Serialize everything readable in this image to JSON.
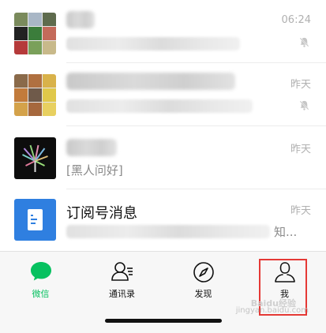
{
  "chats": [
    {
      "time": "06:24",
      "muted": true
    },
    {
      "time": "昨天",
      "muted": true
    },
    {
      "time": "昨天",
      "muted": false,
      "preview": "[黑人问好]"
    },
    {
      "time": "昨天",
      "muted": false,
      "name": "订阅号消息",
      "preview_suffix": "知..."
    }
  ],
  "tabs": [
    {
      "label": "微信",
      "icon": "chat-bubble-icon",
      "active": true
    },
    {
      "label": "通讯录",
      "icon": "contacts-icon",
      "active": false
    },
    {
      "label": "发现",
      "icon": "compass-icon",
      "active": false
    },
    {
      "label": "我",
      "icon": "person-icon",
      "active": false
    }
  ],
  "watermark": {
    "text": "jingyan.baidu.com",
    "logo": "Baidu经验"
  },
  "colors": {
    "accent": "#07c160",
    "highlight": "#e53935"
  }
}
